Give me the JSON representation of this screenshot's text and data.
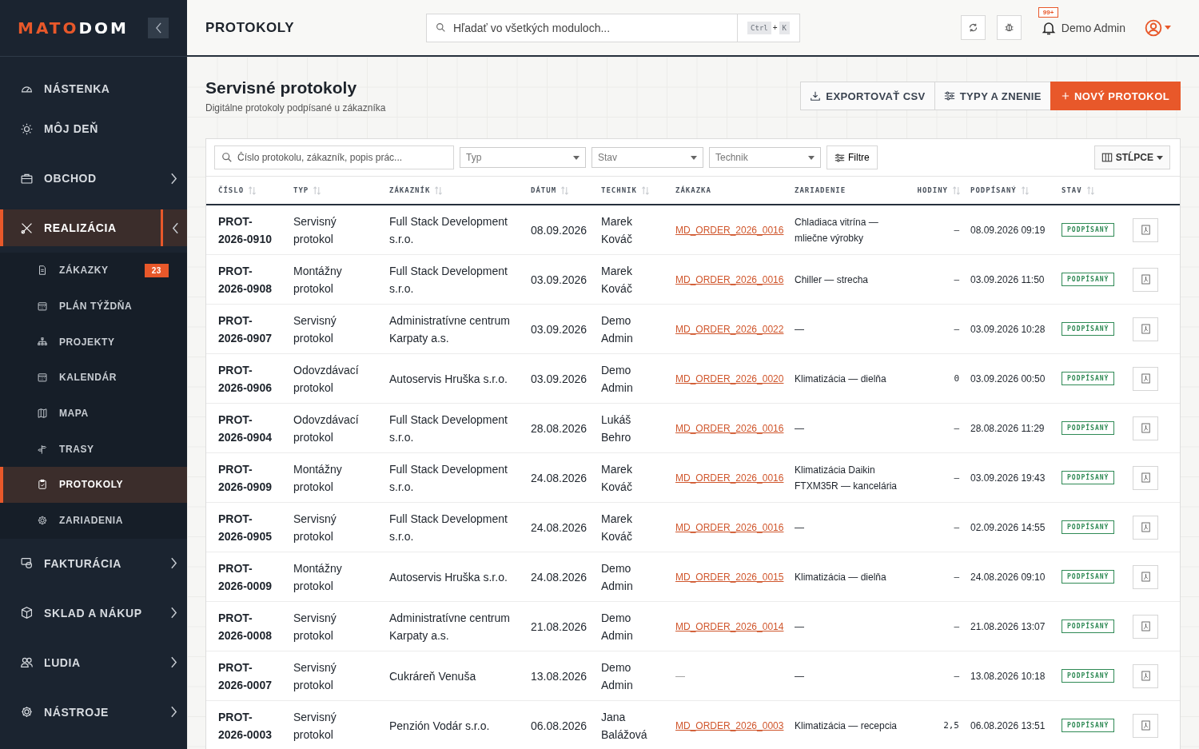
{
  "logo": {
    "accent": "MATO",
    "rest": "DOM"
  },
  "sidebar": {
    "items": [
      {
        "label": "NÁSTENKA",
        "kind": "link",
        "selected": false
      },
      {
        "label": "MÔJ DEŇ",
        "kind": "link",
        "selected": false
      },
      {
        "label": "OBCHOD",
        "kind": "group",
        "expanded": false,
        "selected": false
      },
      {
        "label": "REALIZÁCIA",
        "kind": "group",
        "expanded": true,
        "selected": true,
        "children": [
          {
            "label": "ZÁKAZKY",
            "selected": false,
            "badge": "23"
          },
          {
            "label": "PLÁN TÝŽDŇA",
            "selected": false
          },
          {
            "label": "PROJEKTY",
            "selected": false
          },
          {
            "label": "KALENDÁR",
            "selected": false
          },
          {
            "label": "MAPA",
            "selected": false
          },
          {
            "label": "TRASY",
            "selected": false
          },
          {
            "label": "PROTOKOLY",
            "selected": true
          },
          {
            "label": "ZARIADENIA",
            "selected": false
          }
        ]
      },
      {
        "label": "FAKTURÁCIA",
        "kind": "group",
        "expanded": false,
        "selected": false
      },
      {
        "label": "SKLAD A NÁKUP",
        "kind": "group",
        "expanded": false,
        "selected": false
      },
      {
        "label": "ĽUDIA",
        "kind": "group",
        "expanded": false,
        "selected": false
      },
      {
        "label": "NÁSTROJE",
        "kind": "group",
        "expanded": false,
        "selected": false
      }
    ]
  },
  "topbar": {
    "title": "PROTOKOLY",
    "search": {
      "placeholder": "Hľadať vo všetkých moduloch...",
      "shortcut": [
        "Ctrl",
        "+",
        "K"
      ]
    },
    "notifications": "99+",
    "user": "Demo Admin"
  },
  "page": {
    "title": "Servisné protokoly",
    "subtitle": "Digitálne protokoly podpísané u zákazníka",
    "actions": [
      {
        "label": "EXPORTOVAŤ CSV",
        "kind": "export"
      },
      {
        "label": "TYPY A ZNENIE",
        "kind": "settings"
      },
      {
        "label": "NOVÝ PROTOKOL",
        "kind": "primary"
      }
    ]
  },
  "filters": {
    "search": {
      "placeholder": "Číslo protokolu, zákazník, popis prác..."
    },
    "selects": [
      {
        "placeholder": "Typ"
      },
      {
        "placeholder": "Stav"
      },
      {
        "placeholder": "Technik"
      }
    ],
    "filter_button": "Filtre",
    "columns_button": "STĹPCE"
  },
  "table": {
    "columns": [
      {
        "label": "ČÍSLO",
        "sortable": true
      },
      {
        "label": "TYP",
        "sortable": true
      },
      {
        "label": "ZÁKAZNÍK",
        "sortable": true
      },
      {
        "label": "DÁTUM",
        "sortable": true
      },
      {
        "label": "TECHNIK",
        "sortable": true
      },
      {
        "label": "ZÁKAZKA",
        "sortable": false
      },
      {
        "label": "ZARIADENIE",
        "sortable": false
      },
      {
        "label": "HODINY",
        "sortable": true
      },
      {
        "label": "PODPÍSANÝ",
        "sortable": true
      },
      {
        "label": "STAV",
        "sortable": true
      }
    ],
    "rows": [
      {
        "number": "PROT-2026-0910",
        "type": "Servisný protokol",
        "customer": "Full Stack Development s.r.o.",
        "date": "08.09.2026",
        "technician": "Marek Kováč",
        "order": "MD_ORDER_2026_0016",
        "order_linked": true,
        "device": "Chladiaca vitrína — mliečne výrobky",
        "hours": "—",
        "signed": "08.09.2026 09:19",
        "status": "PODPÍSANÝ"
      },
      {
        "number": "PROT-2026-0908",
        "type": "Montážny protokol",
        "customer": "Full Stack Development s.r.o.",
        "date": "03.09.2026",
        "technician": "Marek Kováč",
        "order": "MD_ORDER_2026_0016",
        "order_linked": true,
        "device": "Chiller — strecha",
        "hours": "—",
        "signed": "03.09.2026 11:50",
        "status": "PODPÍSANÝ"
      },
      {
        "number": "PROT-2026-0907",
        "type": "Servisný protokol",
        "customer": "Administratívne centrum Karpaty a.s.",
        "date": "03.09.2026",
        "technician": "Demo Admin",
        "order": "MD_ORDER_2026_0022",
        "order_linked": true,
        "device": "—",
        "hours": "—",
        "signed": "03.09.2026 10:28",
        "status": "PODPÍSANÝ"
      },
      {
        "number": "PROT-2026-0906",
        "type": "Odovzdávací protokol",
        "customer": "Autoservis Hruška s.r.o.",
        "date": "03.09.2026",
        "technician": "Demo Admin",
        "order": "MD_ORDER_2026_0020",
        "order_linked": true,
        "device": "Klimatizácia — dielňa",
        "hours": "0",
        "signed": "03.09.2026 00:50",
        "status": "PODPÍSANÝ"
      },
      {
        "number": "PROT-2026-0904",
        "type": "Odovzdávací protokol",
        "customer": "Full Stack Development s.r.o.",
        "date": "28.08.2026",
        "technician": "Lukáš Behro",
        "order": "MD_ORDER_2026_0016",
        "order_linked": true,
        "device": "—",
        "hours": "—",
        "signed": "28.08.2026 11:29",
        "status": "PODPÍSANÝ"
      },
      {
        "number": "PROT-2026-0909",
        "type": "Montážny protokol",
        "customer": "Full Stack Development s.r.o.",
        "date": "24.08.2026",
        "technician": "Marek Kováč",
        "order": "MD_ORDER_2026_0016",
        "order_linked": true,
        "device": "Klimatizácia Daikin FTXM35R — kancelária",
        "hours": "—",
        "signed": "03.09.2026 19:43",
        "status": "PODPÍSANÝ"
      },
      {
        "number": "PROT-2026-0905",
        "type": "Servisný protokol",
        "customer": "Full Stack Development s.r.o.",
        "date": "24.08.2026",
        "technician": "Marek Kováč",
        "order": "MD_ORDER_2026_0016",
        "order_linked": true,
        "device": "—",
        "hours": "—",
        "signed": "02.09.2026 14:55",
        "status": "PODPÍSANÝ"
      },
      {
        "number": "PROT-2026-0009",
        "type": "Montážny protokol",
        "customer": "Autoservis Hruška s.r.o.",
        "date": "24.08.2026",
        "technician": "Demo Admin",
        "order": "MD_ORDER_2026_0015",
        "order_linked": true,
        "device": "Klimatizácia — dielňa",
        "hours": "—",
        "signed": "24.08.2026 09:10",
        "status": "PODPÍSANÝ"
      },
      {
        "number": "PROT-2026-0008",
        "type": "Servisný protokol",
        "customer": "Administratívne centrum Karpaty a.s.",
        "date": "21.08.2026",
        "technician": "Demo Admin",
        "order": "MD_ORDER_2026_0014",
        "order_linked": true,
        "device": "—",
        "hours": "—",
        "signed": "21.08.2026 13:07",
        "status": "PODPÍSANÝ"
      },
      {
        "number": "PROT-2026-0007",
        "type": "Servisný protokol",
        "customer": "Cukráreň Venuša",
        "date": "13.08.2026",
        "technician": "Demo Admin",
        "order": "—",
        "order_linked": false,
        "device": "—",
        "hours": "—",
        "signed": "13.08.2026 10:18",
        "status": "PODPÍSANÝ"
      },
      {
        "number": "PROT-2026-0003",
        "type": "Servisný protokol",
        "customer": "Penzión Vodár s.r.o.",
        "date": "06.08.2026",
        "technician": "Jana Balážová",
        "order": "MD_ORDER_2026_0003",
        "order_linked": true,
        "device": "Klimatizácia — recepcia",
        "hours": "2,5",
        "signed": "06.08.2026 13:51",
        "status": "PODPÍSANÝ"
      }
    ]
  }
}
